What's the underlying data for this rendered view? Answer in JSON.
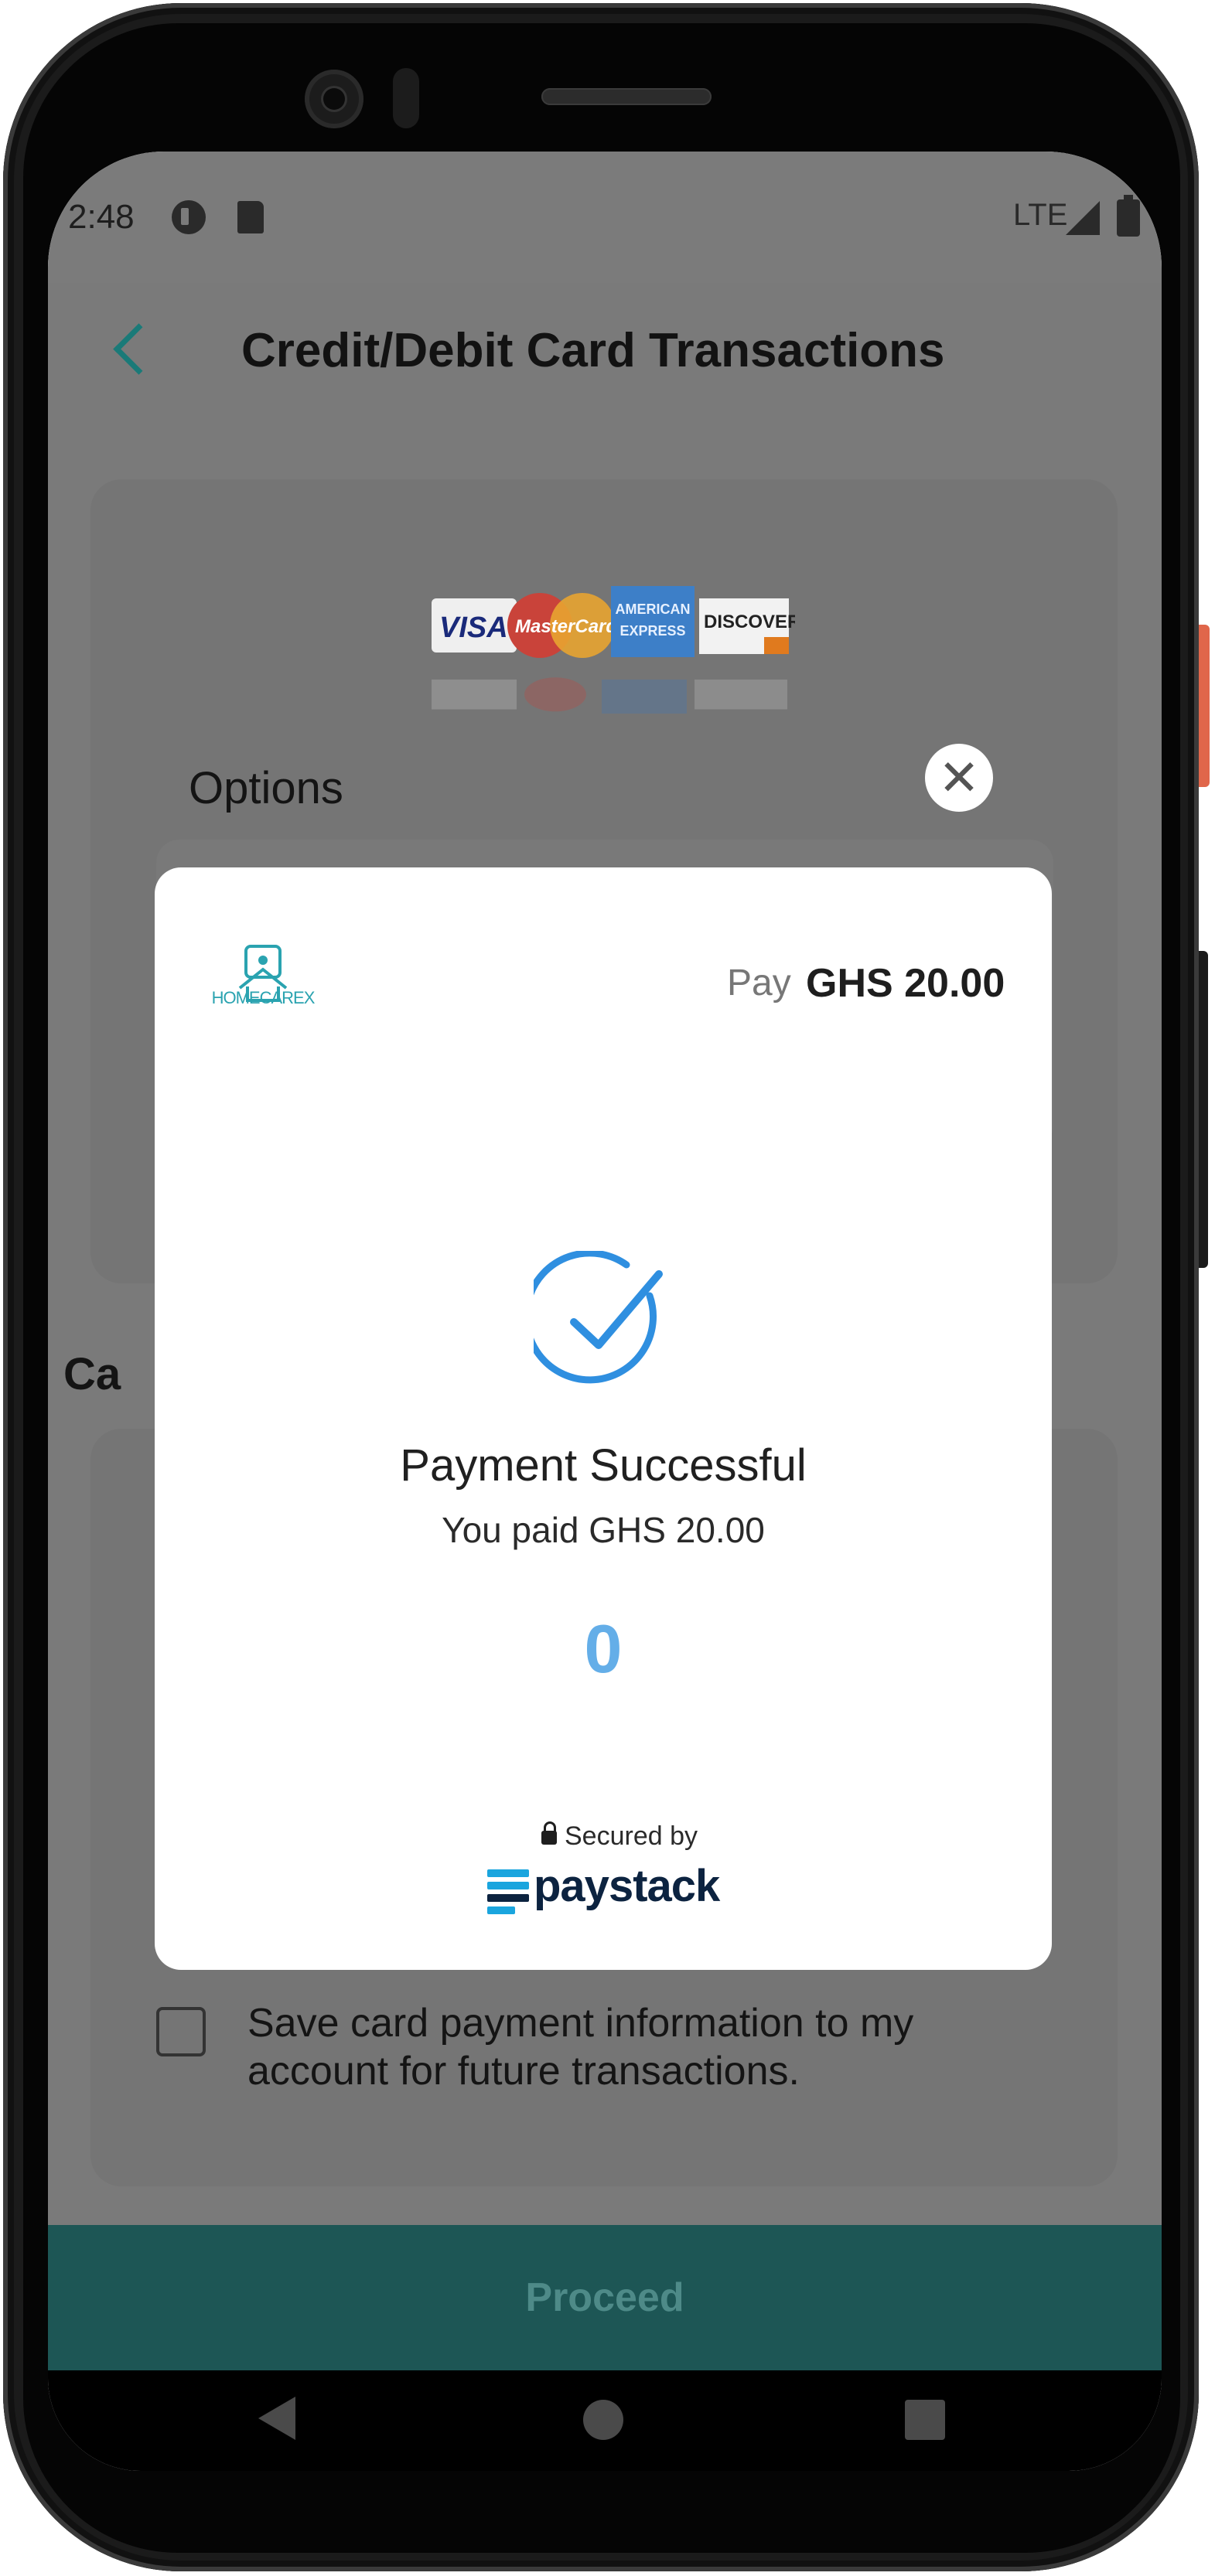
{
  "status_bar": {
    "time": "2:48",
    "network": "LTE",
    "icons": [
      "data-saver-icon",
      "sd-card-icon",
      "signal-icon",
      "battery-icon"
    ]
  },
  "header": {
    "title": "Credit/Debit Card Transactions",
    "back_icon": "chevron-left-icon"
  },
  "card_brands": [
    "VISA",
    "MasterCard",
    "AMERICAN EXPRESS",
    "DISCOVER"
  ],
  "options_label": "Options",
  "cards_label_partial": "Ca",
  "save_card": {
    "checked": false,
    "label": "Save card payment information to my account for future transactions."
  },
  "proceed_button": "Proceed",
  "modal": {
    "merchant_name": "HOMECAREX",
    "pay_label": "Pay",
    "amount": "GHS 20.00",
    "status_title": "Payment Successful",
    "status_message": "You paid GHS 20.00",
    "countdown": "0",
    "secured_by": "Secured by",
    "provider": "paystack"
  },
  "colors": {
    "accent_teal": "#1a7a78",
    "proceed_bg": "#1d5655",
    "success_blue": "#2f8fe0",
    "countdown_blue": "#64aee8",
    "paystack_navy": "#0c2340",
    "paystack_blue": "#1aa5de"
  }
}
